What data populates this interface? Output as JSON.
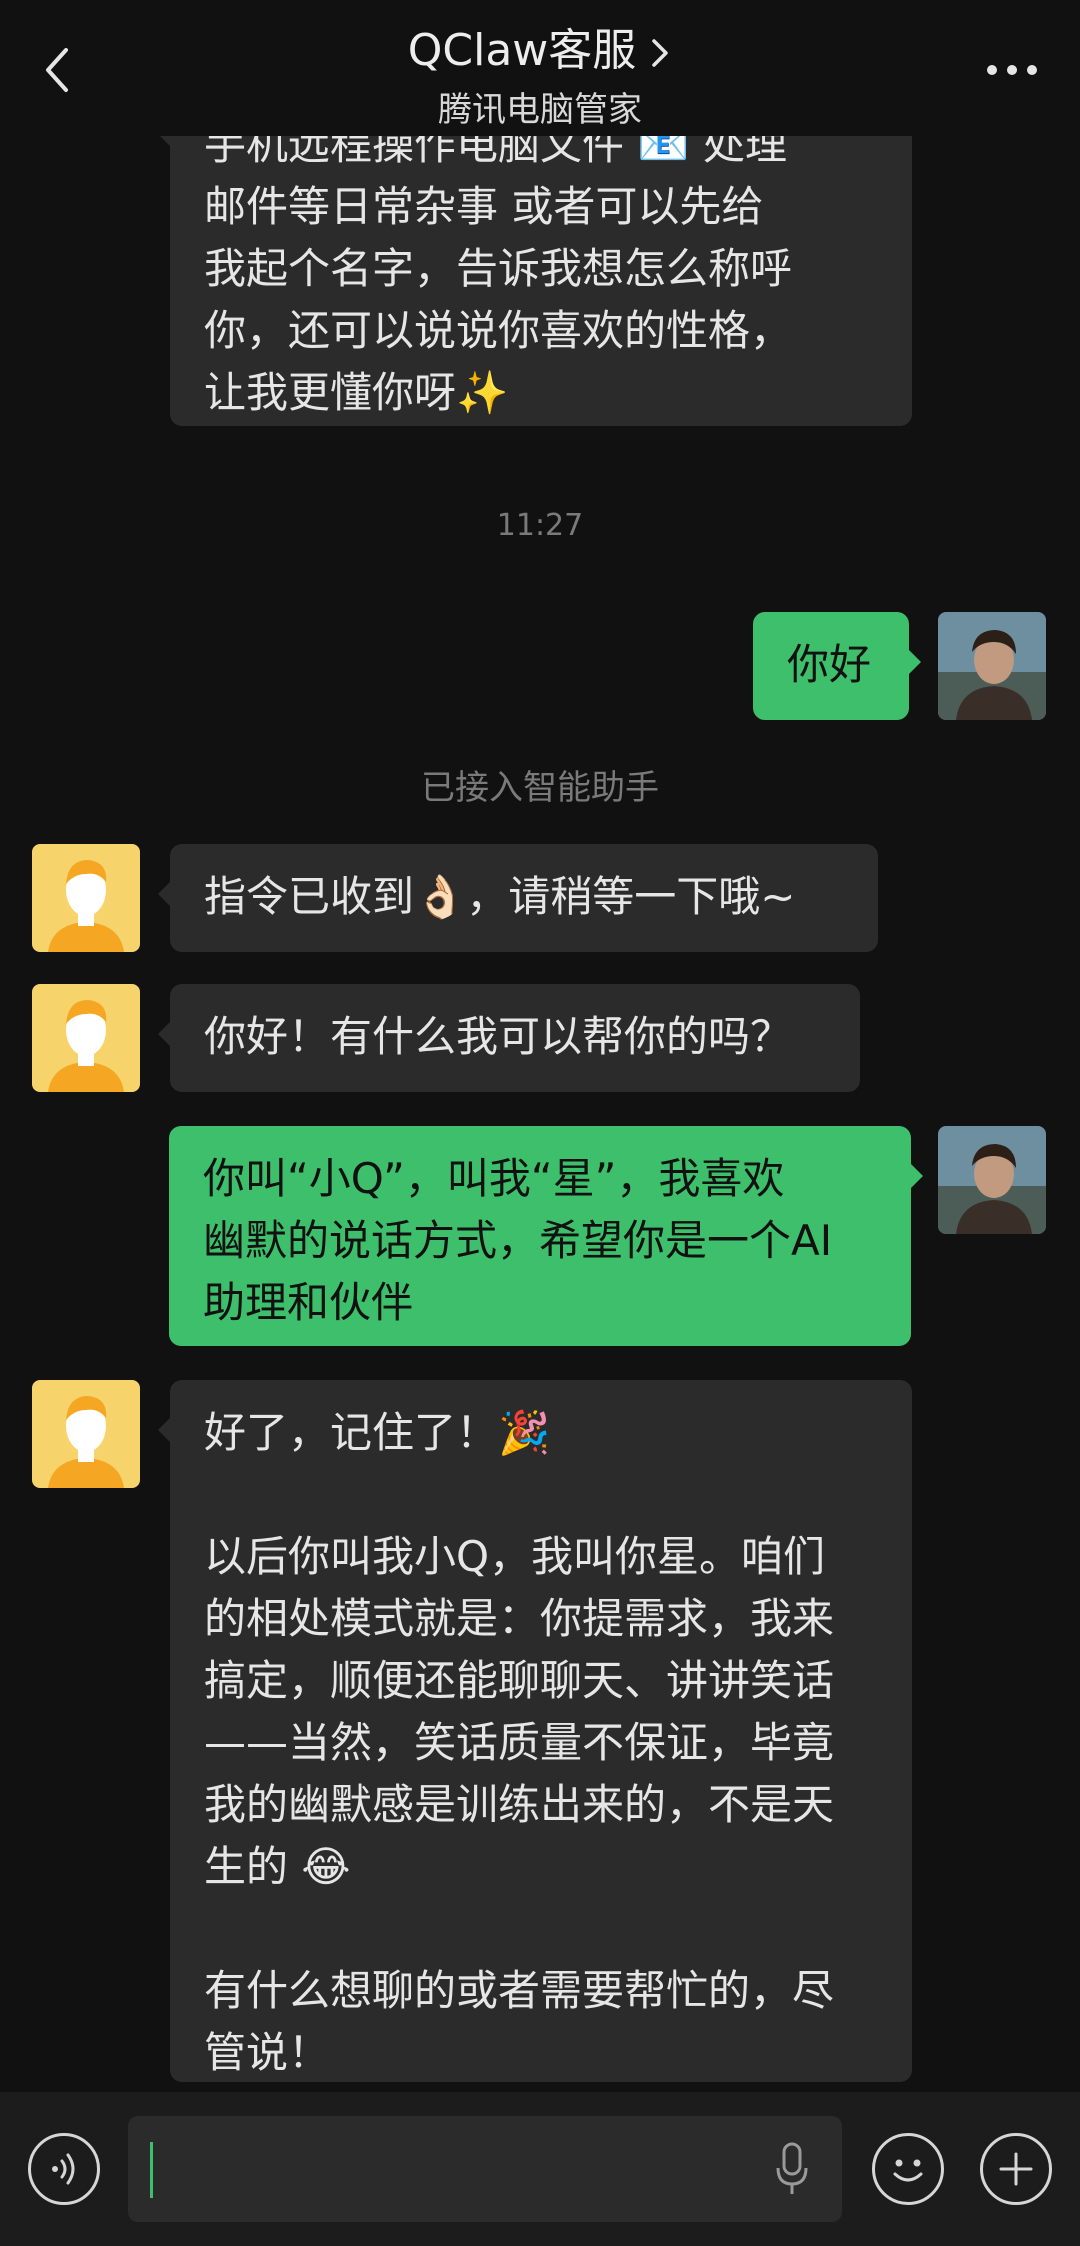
{
  "header": {
    "title": "QClaw客服",
    "subtitle": "腾讯电脑管家"
  },
  "messages": {
    "m0": "手机远程操作电脑文件 📧 处理\n邮件等日常杂事 或者可以先给\n我起个名字，告诉我想怎么称呼\n你，还可以说说你喜欢的性格，\n让我更懂你呀✨",
    "time": "11:27",
    "m1": "你好",
    "system": "已接入智能助手",
    "m2": "指令已收到👌🏻，请稍等一下哦~",
    "m3": "你好！有什么我可以帮你的吗？",
    "m4": "你叫“小Q”，叫我“星”，我喜欢\n幽默的说话方式，希望你是一个AI\n助理和伙伴",
    "m5": "好了，记住了！🎉\n\n以后你叫我小Q，我叫你星。咱们\n的相处模式就是：你提需求，我来\n搞定，顺便还能聊聊天、讲讲笑话\n——当然，笑话质量不保证，毕竟\n我的幽默感是训练出来的，不是天\n生的 😂\n\n有什么想聊的或者需要帮忙的，尽\n管说！"
  },
  "colors": {
    "background": "#111111",
    "bubble_self": "#3ebf6b",
    "bubble_other": "#2b2b2b",
    "cursor": "#3ebf6b"
  },
  "icons": {
    "back": "chevron-left-icon",
    "more": "more-dots-icon",
    "voice": "voice-icon",
    "mic": "microphone-icon",
    "emoji": "emoji-icon",
    "add": "plus-icon"
  }
}
